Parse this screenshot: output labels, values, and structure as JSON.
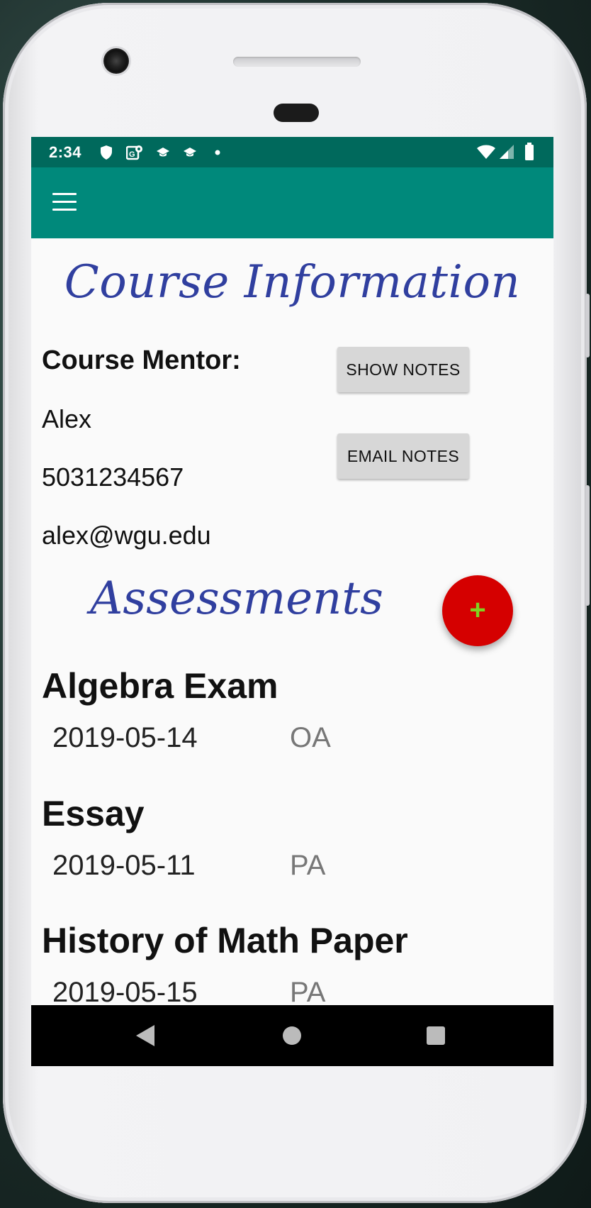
{
  "status_bar": {
    "time": "2:34",
    "icons": [
      "shield-icon",
      "maps-icon",
      "school-icon",
      "school-icon",
      "dot-icon",
      "wifi-icon",
      "signal-icon",
      "battery-icon"
    ]
  },
  "app_bar": {
    "menu_icon": "hamburger-menu-icon",
    "color": "#00897b",
    "status_color": "#00695c"
  },
  "course": {
    "title": "Course Information",
    "mentor_label": "Course Mentor:",
    "mentor_name": "Alex",
    "mentor_phone": "5031234567",
    "mentor_email": "alex@wgu.edu",
    "show_notes_label": "SHOW NOTES",
    "email_notes_label": "EMAIL NOTES"
  },
  "assessments": {
    "title": "Assessments",
    "add_button_label": "+",
    "fab_color": "#d50000",
    "items": [
      {
        "name": "Algebra Exam",
        "date": "2019-05-14",
        "type": "OA"
      },
      {
        "name": "Essay",
        "date": "2019-05-11",
        "type": "PA"
      },
      {
        "name": "History of Math Paper",
        "date": "2019-05-15",
        "type": "PA"
      }
    ]
  },
  "nav_bar": {
    "icons": [
      "back-icon",
      "home-icon",
      "recents-icon"
    ]
  }
}
